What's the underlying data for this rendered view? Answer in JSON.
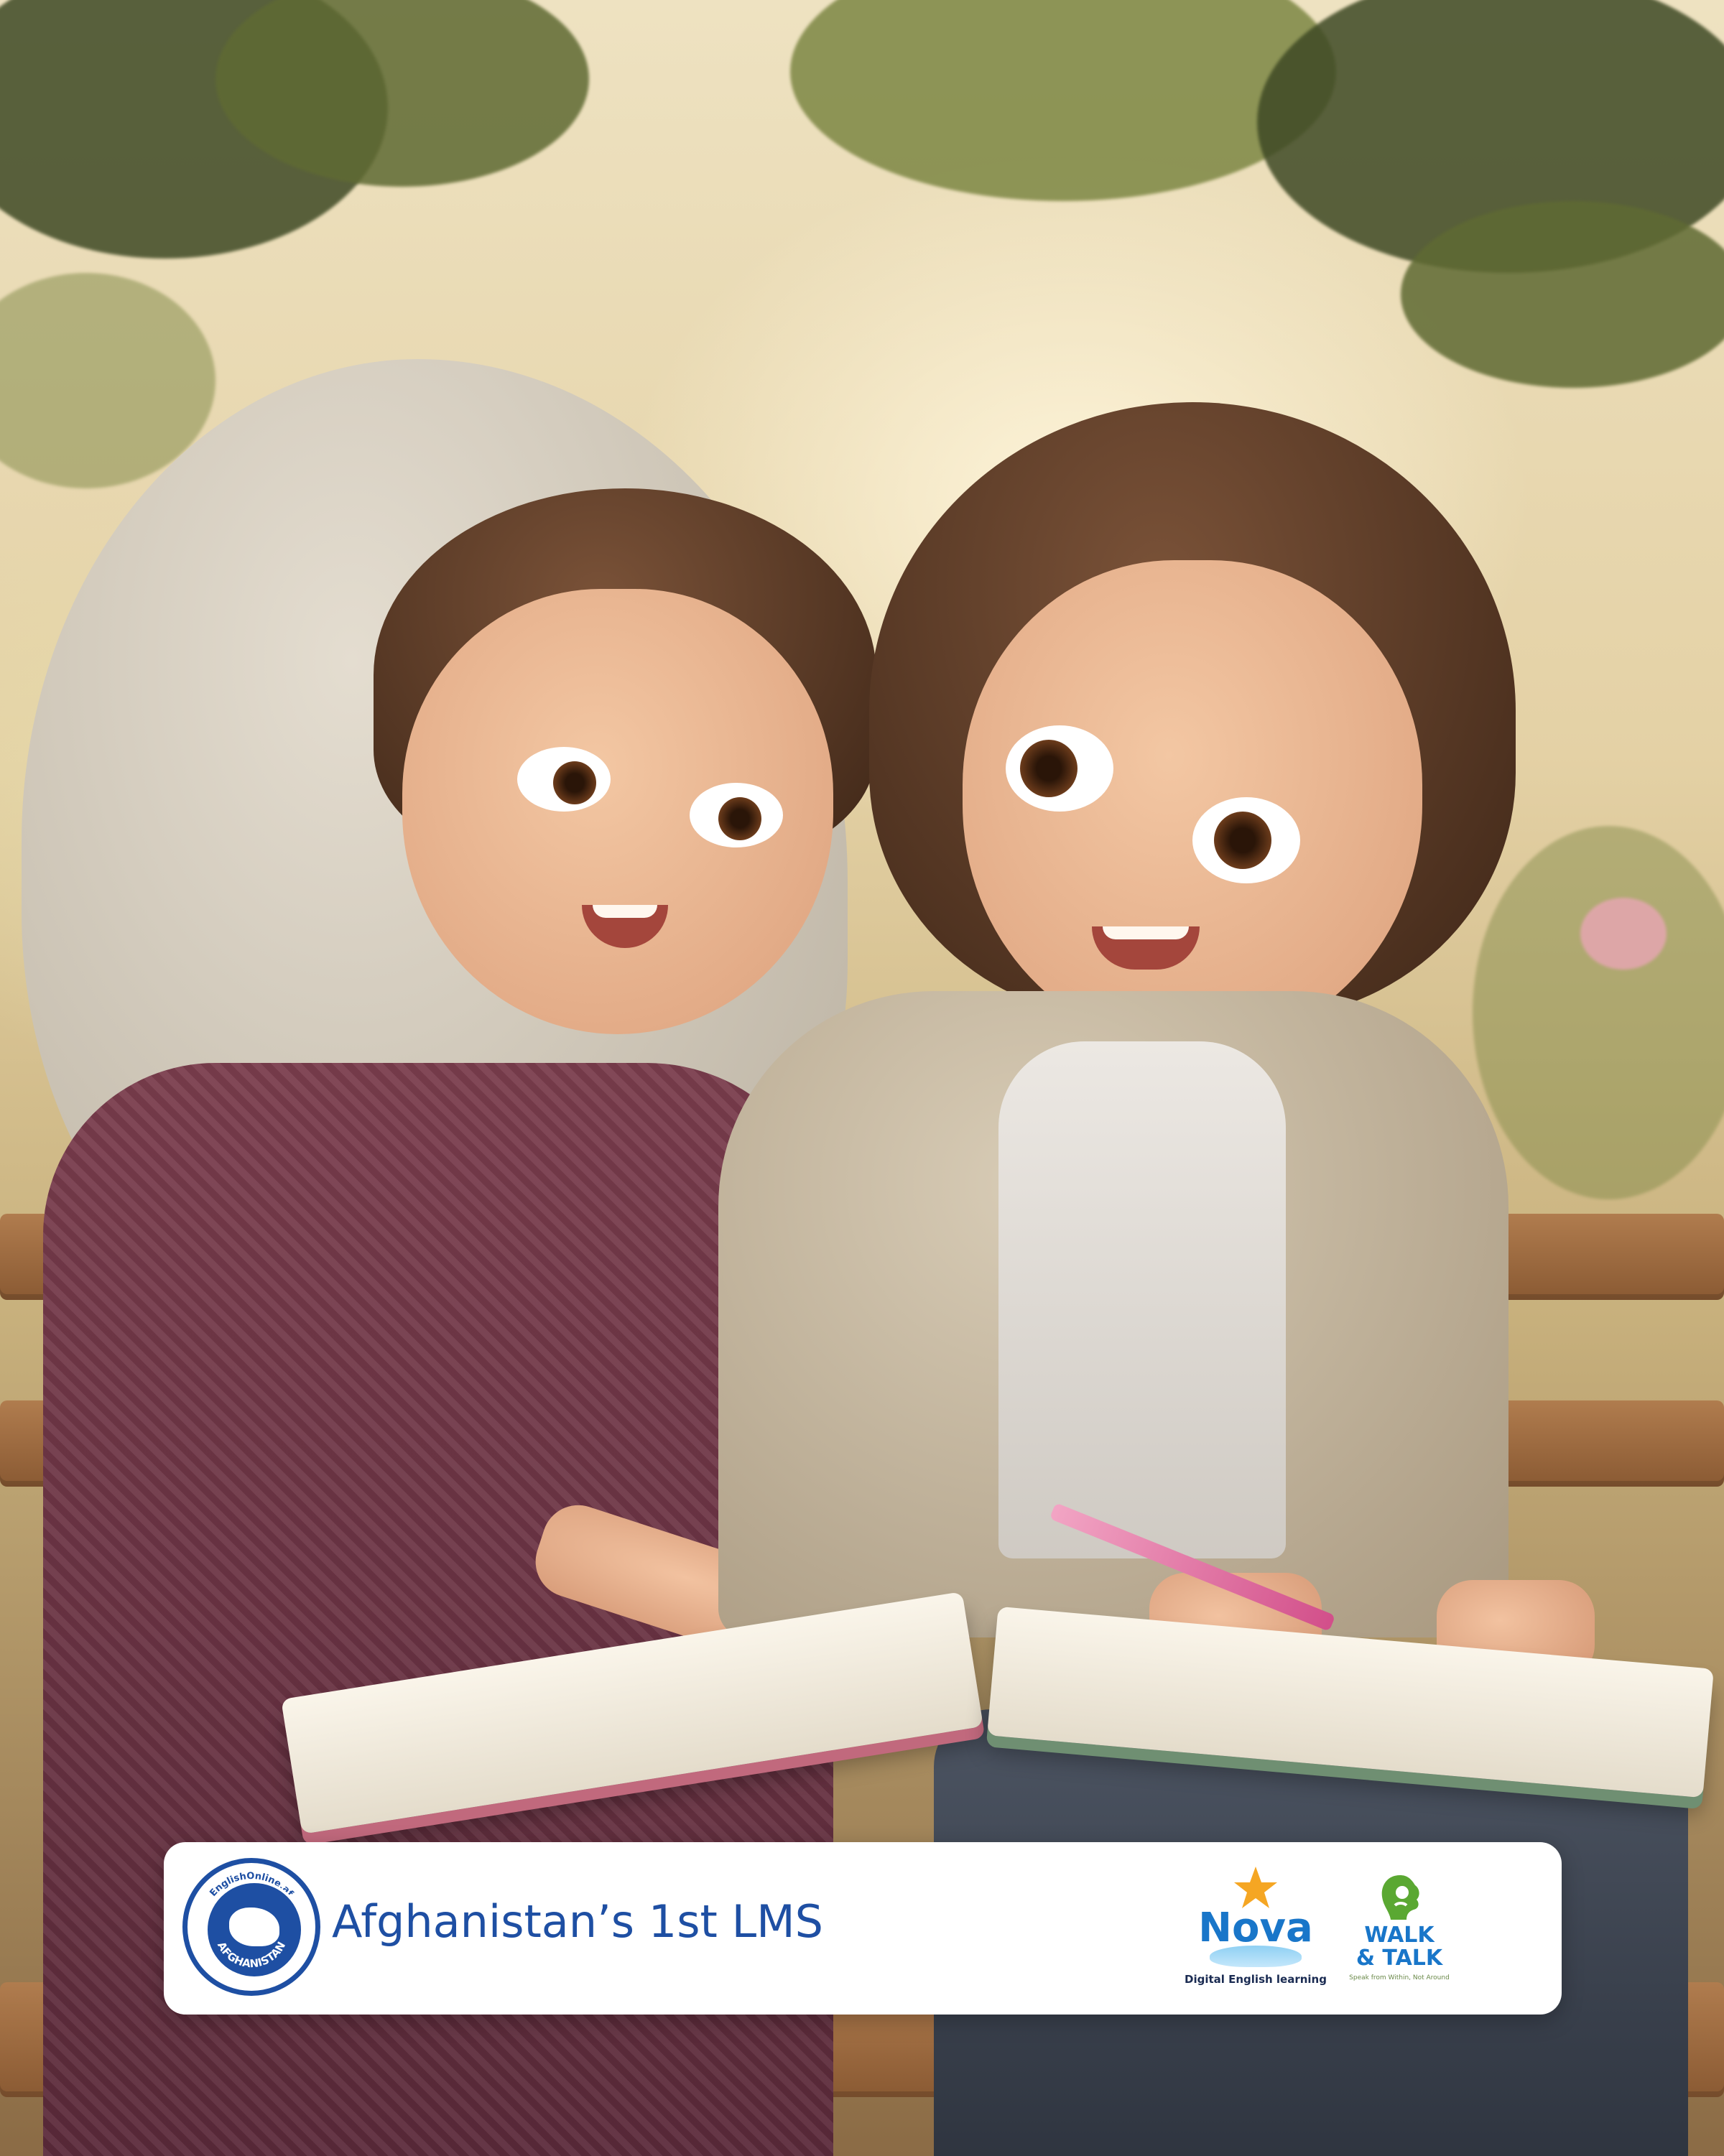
{
  "brand_bar": {
    "tagline": "Afghanistan’s 1st LMS",
    "seal": {
      "ring_text_top": "EnglishOnline.af",
      "ring_text_bottom": "AFGHANISTAN",
      "color": "#1e4fa3"
    },
    "partner_logos": [
      {
        "name": "Nova",
        "subtitle": "Digital English learning",
        "color": "#1976c9",
        "accent": "#f5a623"
      },
      {
        "name": "WALK & TALK",
        "subtitle": "Speak from Within, Not Around",
        "color": "#1976c9",
        "accent": "#5aa832"
      }
    ]
  },
  "scene": {
    "description_icons": [
      "tree-foliage-icon",
      "bench-icon",
      "open-book-icon",
      "pencil-icon"
    ]
  }
}
